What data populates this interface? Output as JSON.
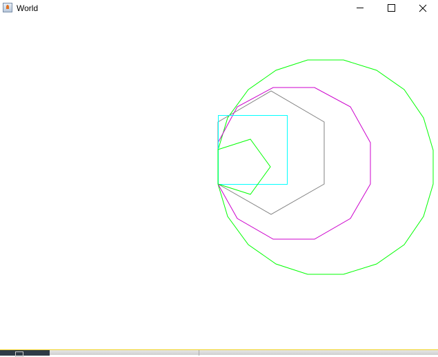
{
  "window": {
    "title": "World",
    "icon": "java-icon"
  },
  "controls": {
    "minimize": "minimize-icon",
    "maximize": "maximize-icon",
    "close": "close-icon"
  },
  "shapes": {
    "colors": {
      "square": "#00ffff",
      "pentagon": "#00ff00",
      "hexagon": "#808080",
      "dodecagon": "#cc00cc",
      "icosagon": "#00ff00"
    }
  }
}
